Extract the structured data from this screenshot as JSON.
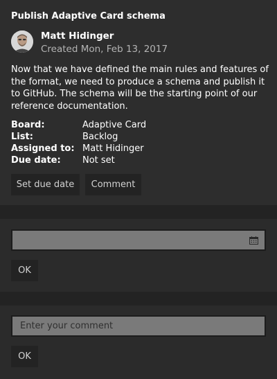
{
  "card": {
    "title": "Publish Adaptive Card schema",
    "author": "Matt Hidinger",
    "created": "Created Mon, Feb 13, 2017",
    "description": "Now that we have defined the main rules and features of the format, we need to produce a schema and publish it to GitHub. The schema will be the starting point of our reference documentation.",
    "facts": [
      {
        "title": "Board:",
        "value": "Adaptive Card"
      },
      {
        "title": "List:",
        "value": "Backlog"
      },
      {
        "title": "Assigned to:",
        "value": "Matt Hidinger"
      },
      {
        "title": "Due date:",
        "value": "Not set"
      }
    ],
    "actions": {
      "due_date_label": "Set due date",
      "comment_label": "Comment"
    }
  },
  "due_date_panel": {
    "date_value": "",
    "ok_label": "OK"
  },
  "comment_panel": {
    "placeholder": "Enter your comment",
    "ok_label": "OK"
  },
  "colors": {
    "card_background": "#2d2d2d",
    "separator": "#232323",
    "input_background": "#7a7a7a",
    "button_background": "#232323"
  }
}
